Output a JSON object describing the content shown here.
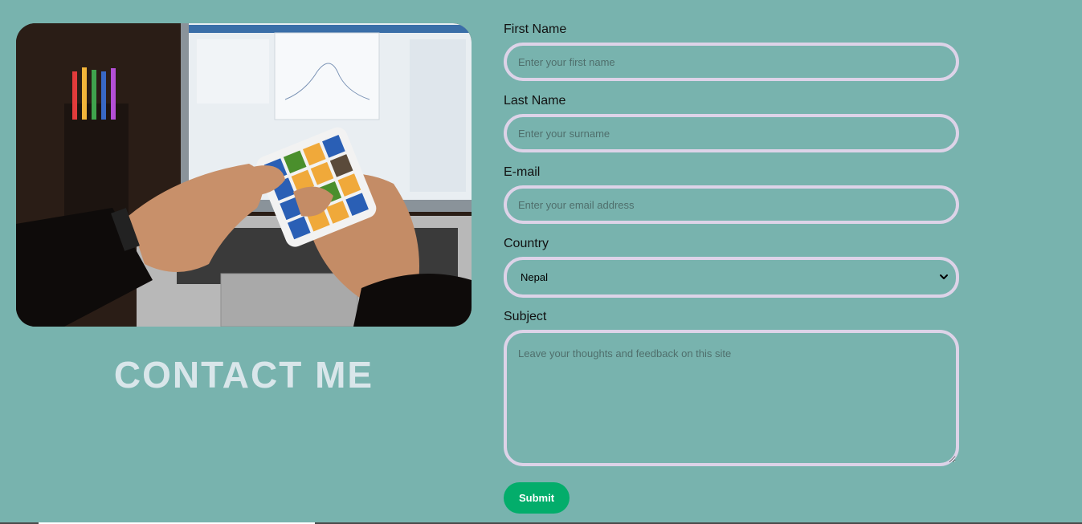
{
  "hero": {
    "heading": "CONTACT ME",
    "image_icon": "rubiks-cube-photo"
  },
  "form": {
    "first_name": {
      "label": "First Name",
      "placeholder": "Enter your first name",
      "value": ""
    },
    "last_name": {
      "label": "Last Name",
      "placeholder": "Enter your surname",
      "value": ""
    },
    "email": {
      "label": "E-mail",
      "placeholder": "Enter your email address",
      "value": ""
    },
    "country": {
      "label": "Country",
      "selected": "Nepal",
      "icon": "chevron-down-icon"
    },
    "subject": {
      "label": "Subject",
      "placeholder": "Leave your thoughts and feedback on this site",
      "value": ""
    },
    "submit_label": "Submit"
  },
  "colors": {
    "background": "#78b3ae",
    "field_border": "#ddd3e8",
    "submit": "#03ad6b",
    "heading": "#d9e6ea"
  }
}
